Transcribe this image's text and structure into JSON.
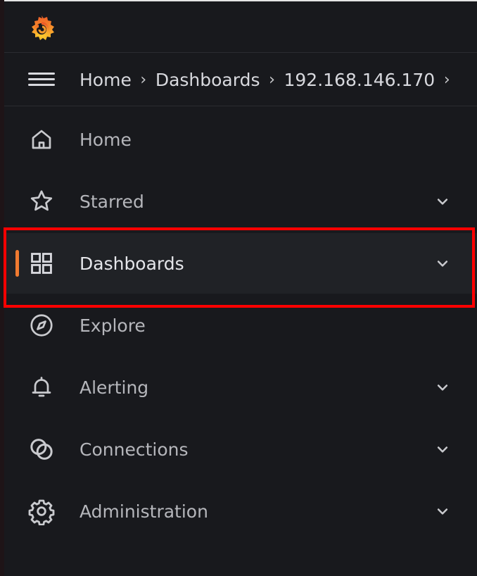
{
  "breadcrumb": {
    "items": [
      "Home",
      "Dashboards",
      "192.168.146.170"
    ],
    "separator": "›"
  },
  "nav": {
    "items": [
      {
        "label": "Home",
        "icon": "home-icon",
        "expandable": false
      },
      {
        "label": "Starred",
        "icon": "star-icon",
        "expandable": true
      },
      {
        "label": "Dashboards",
        "icon": "apps-grid-icon",
        "expandable": true,
        "active": true
      },
      {
        "label": "Explore",
        "icon": "compass-icon",
        "expandable": false
      },
      {
        "label": "Alerting",
        "icon": "bell-icon",
        "expandable": true
      },
      {
        "label": "Connections",
        "icon": "connections-icon",
        "expandable": true
      },
      {
        "label": "Administration",
        "icon": "gear-icon",
        "expandable": true
      }
    ]
  },
  "colors": {
    "background": "#18191d",
    "active_accent": "#f07a30",
    "highlight_box": "#ff0000",
    "text": "#d8d9de"
  }
}
